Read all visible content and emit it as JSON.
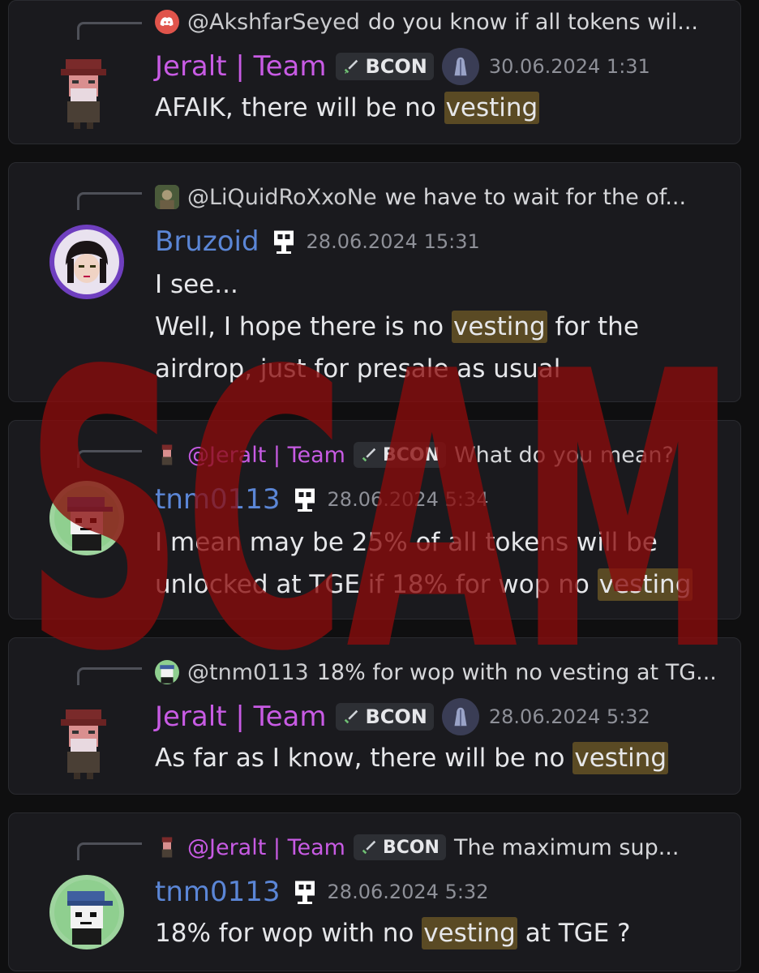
{
  "messages": [
    {
      "reply": {
        "author": "@AkshfarSeyed",
        "text": "do you know if all tokens wil..."
      },
      "author": "Jeralt | Team",
      "tag": "BCON",
      "timestamp": "30.06.2024 1:31",
      "lines": [
        {
          "before": "AFAIK, there will be no ",
          "highlight": "vesting",
          "after": ""
        }
      ]
    },
    {
      "reply": {
        "author": "@LiQuidRoXxoNe",
        "text": "we have to wait for the of..."
      },
      "author": "Bruzoid",
      "timestamp": "28.06.2024 15:31",
      "lines": [
        {
          "before": "I see...",
          "highlight": "",
          "after": ""
        },
        {
          "before": "Well, I hope there is no ",
          "highlight": "vesting",
          "after": " for the"
        },
        {
          "before": "airdrop, just for presale as usual",
          "highlight": "",
          "after": ""
        }
      ]
    },
    {
      "reply": {
        "author": "@Jeralt | Team",
        "tag": "BCON",
        "text": "What do you mean?"
      },
      "author": "tnm0113",
      "timestamp": "28.06.2024 5:34",
      "lines": [
        {
          "before": "I mean may be 25% of all tokens will be",
          "highlight": "",
          "after": ""
        },
        {
          "before": "unlocked at TGE if 18% for wop no ",
          "highlight": "vesting",
          "after": ""
        }
      ]
    },
    {
      "reply": {
        "author": "@tnm0113",
        "text": "18% for wop with no vesting at TG..."
      },
      "author": "Jeralt | Team",
      "tag": "BCON",
      "timestamp": "28.06.2024 5:32",
      "lines": [
        {
          "before": "As far as I know, there will be no ",
          "highlight": "vesting",
          "after": ""
        }
      ]
    },
    {
      "reply": {
        "author": "@Jeralt | Team",
        "tag": "BCON",
        "text": "The maximum sup..."
      },
      "author": "tnm0113",
      "timestamp": "28.06.2024 5:32",
      "lines": [
        {
          "before": "18% for wop with no ",
          "highlight": "vesting",
          "after": " at TGE ?"
        }
      ]
    }
  ],
  "watermark": "SCAM",
  "colors": {
    "team_name": "#c85be4",
    "user_name": "#5b86d6",
    "highlight": "#5a4a24",
    "watermark": "#8a0c0c",
    "background": "#0f0f10",
    "card": "#1a1a1e"
  }
}
